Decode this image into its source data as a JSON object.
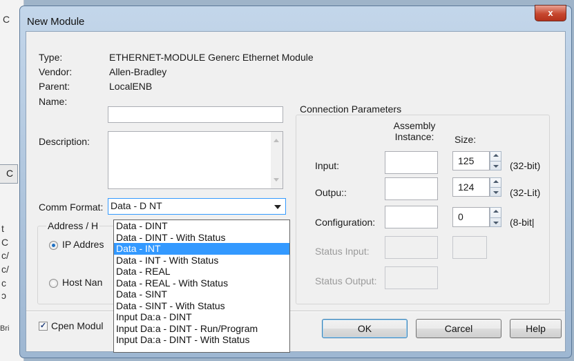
{
  "background": {
    "fragments": [
      "t",
      "C",
      "c/",
      "c/",
      "c",
      "ɔ",
      "Bri"
    ],
    "button_fragment": "C",
    "top_fragment": "C"
  },
  "dialog": {
    "title": "New Module",
    "close_label": "x",
    "type_label": "Type:",
    "type_value": "ETHERNET-MODULE Generc Ethernet Module",
    "vendor_label": "Vendor:",
    "vendor_value": "Allen-Bradley",
    "parent_label": "Parent:",
    "parent_value": "LocalENB",
    "name_label": "Name:",
    "name_value": "",
    "description_label": "Description:",
    "description_value": "",
    "comm_format_label": "Comm Format:",
    "comm_format_value": "Data - D NT",
    "address_group_label": "Address / H",
    "ip_address_label": "IP Addres",
    "host_name_label": "Host Nan",
    "open_module_label": "Cpen Modul",
    "ok_label": "OK",
    "cancel_label": "Carcel",
    "help_label": "Help"
  },
  "comm_format_options": [
    "Data - DINT",
    "Data - DINT - With Status",
    "Data - INT",
    "Data - INT - With Status",
    "Data - REAL",
    "Data - REAL - With Status",
    "Data - SINT",
    "Data - SINT - With Status",
    "Input Da:a - DINT",
    "Input Da:a - DINT - Run/Program",
    "Input Da:a - DINT - With Status"
  ],
  "selected_option_index": 2,
  "connection": {
    "group_label": "Connection Parameters",
    "assembly_header": "Assembly Instance:",
    "size_header": "Size:",
    "input_label": "Input:",
    "input_instance": "",
    "input_size": "125",
    "input_unit": "(32-bit)",
    "output_label": "Outpu::",
    "output_instance": "",
    "output_size": "124",
    "output_unit": "(32-Lit)",
    "config_label": "Configuration:",
    "config_instance": "",
    "config_size": "0",
    "config_unit": "(8-bit|",
    "status_input_label": "Status Input:",
    "status_output_label": "Status Output:"
  },
  "open_module_checked": true,
  "ip_address_selected": true
}
